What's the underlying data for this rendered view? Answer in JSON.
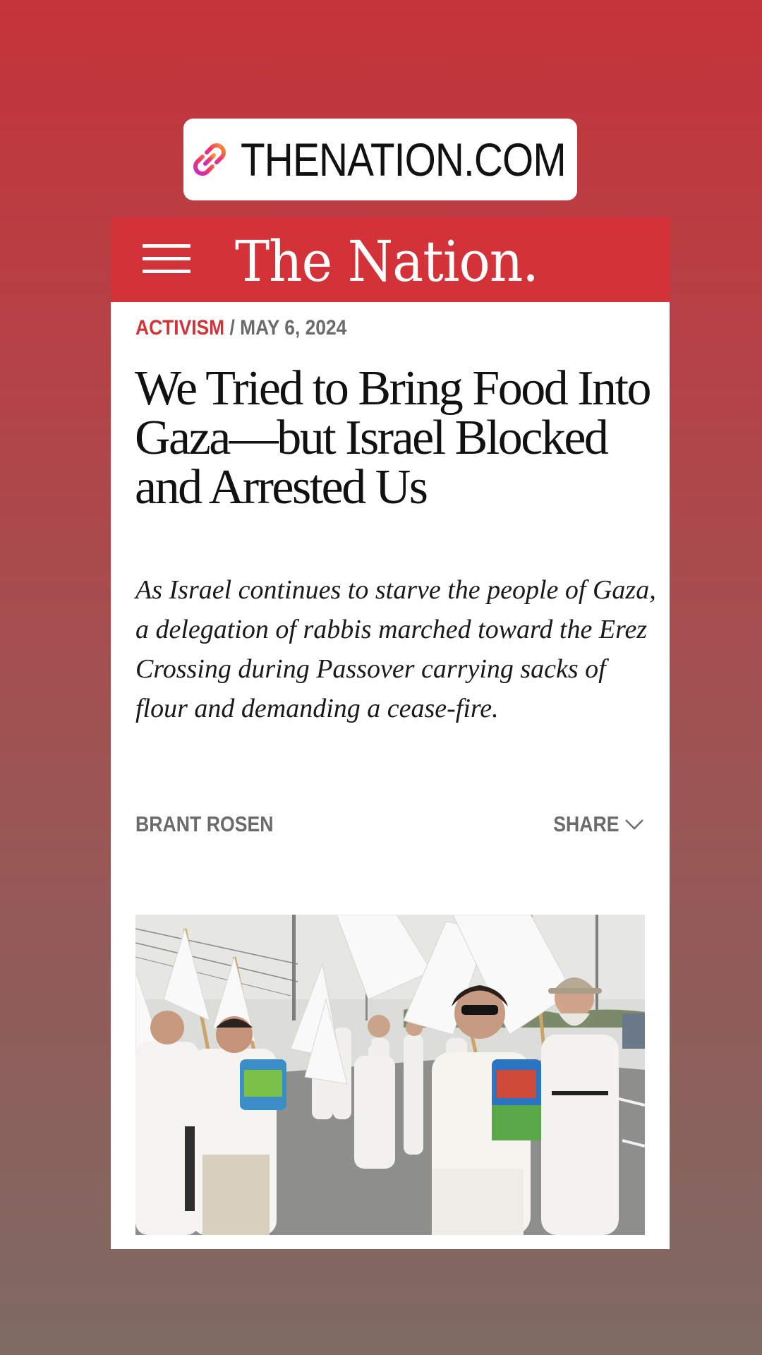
{
  "link_sticker": {
    "text": "THENATION.COM",
    "icon": "link-icon"
  },
  "site": {
    "logo": "The Nation.",
    "menu_icon": "hamburger-menu-icon",
    "brand_color": "#d33338"
  },
  "article": {
    "category": "ACTIVISM",
    "separator": " / ",
    "date": "MAY 6, 2024",
    "headline": "We Tried to Bring Food Into Gaza—but Israel Blocked and Arrested Us",
    "dek": "As Israel continues to starve the people of Gaza, a delegation of rabbis marched toward the Erez Crossing during Passover carrying sacks of flour and demanding a cease-fire.",
    "author": "BRANT ROSEN",
    "share_label": "SHARE",
    "share_icon": "chevron-down-icon",
    "hero_image": "photo of rabbis in white marching with white flags and sacks of flour"
  }
}
